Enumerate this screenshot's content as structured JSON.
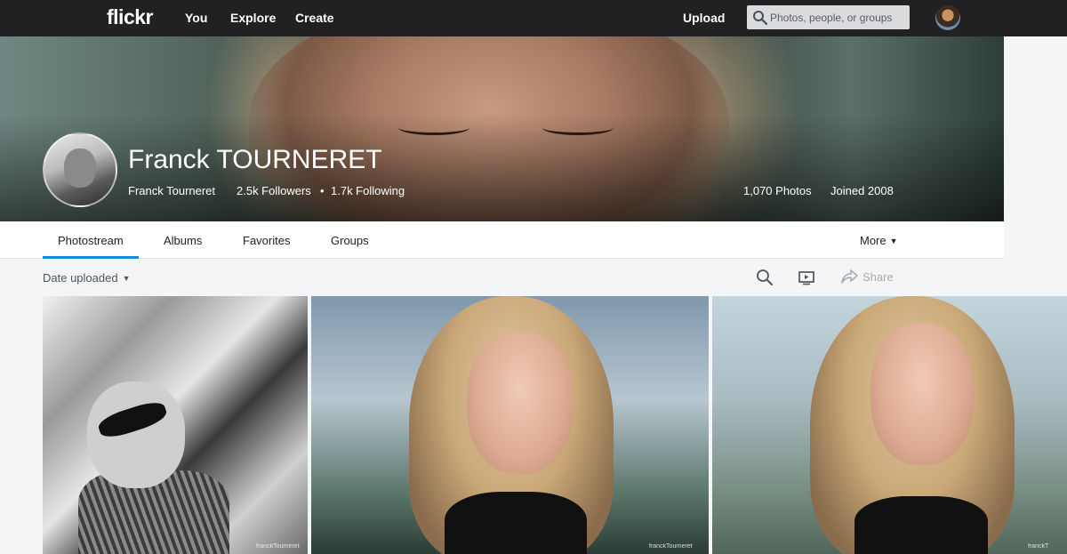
{
  "topnav": {
    "logo": "flickr",
    "links": [
      "You",
      "Explore",
      "Create"
    ],
    "upload": "Upload",
    "search_placeholder": "Photos, people, or groups"
  },
  "profile": {
    "name": "Franck TOURNERET",
    "username": "Franck Tourneret",
    "followers": "2.5k Followers",
    "following": "1.7k Following",
    "photos": "1,070 Photos",
    "joined": "Joined 2008"
  },
  "tabs": [
    "Photostream",
    "Albums",
    "Favorites",
    "Groups"
  ],
  "more_label": "More",
  "toolbar": {
    "sort": "Date uploaded",
    "share": "Share"
  },
  "photos": [
    {
      "watermark": "franckTourneret"
    },
    {
      "watermark": "franckTourneret"
    },
    {
      "watermark": "franckT"
    }
  ],
  "colors": {
    "nav_bg": "#212124",
    "accent": "#128fdc",
    "page_bg": "#f3f5f6"
  }
}
